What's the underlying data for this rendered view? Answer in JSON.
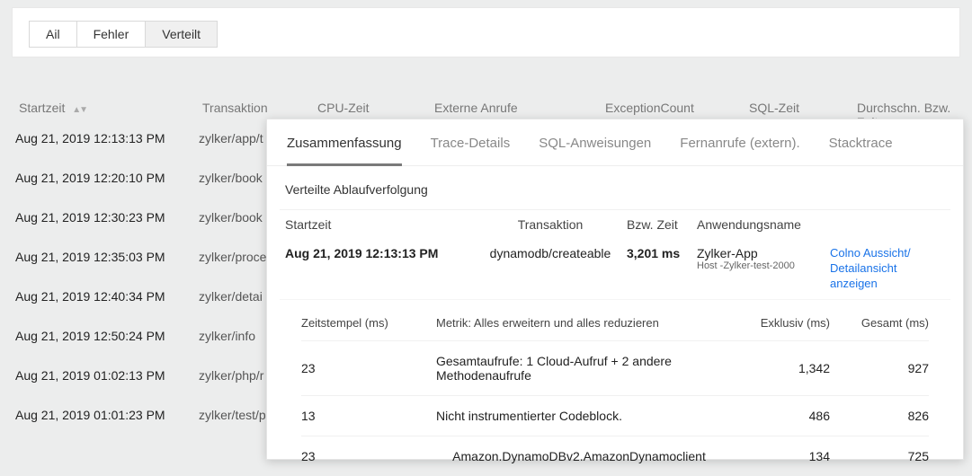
{
  "filters": {
    "all": "Ail",
    "errors": "Fehler",
    "distributed": "Verteilt"
  },
  "columns": {
    "start": "Startzeit",
    "transaction": "Transaktion",
    "cpu": "CPU-Zeit",
    "external": "Externe Anrufe",
    "exception": "ExceptionCount",
    "sql": "SQL-Zeit",
    "avg": "Durchschn. Bzw. Zeit"
  },
  "rows": [
    {
      "start": "Aug 21, 2019 12:13:13 PM",
      "trans": "zylker/app/t"
    },
    {
      "start": "Aug 21, 2019 12:20:10 PM",
      "trans": "zylker/book"
    },
    {
      "start": "Aug 21, 2019 12:30:23 PM",
      "trans": "zylker/book"
    },
    {
      "start": "Aug 21, 2019 12:35:03 PM",
      "trans": "zylker/proce"
    },
    {
      "start": "Aug 21, 2019 12:40:34 PM",
      "trans": "zylker/detai"
    },
    {
      "start": "Aug 21, 2019 12:50:24 PM",
      "trans": "zylker/info"
    },
    {
      "start": "Aug 21, 2019 01:02:13 PM",
      "trans": "zylker/php/r"
    },
    {
      "start": "Aug 21, 2019 01:01:23 PM",
      "trans": "zylker/test/p"
    }
  ],
  "detail_tabs": {
    "summary": "Zusammenfassung",
    "trace": "Trace-Details",
    "sql": "SQL-Anweisungen",
    "remote": "Fernanrufe (extern).",
    "stack": "Stacktrace"
  },
  "section_title": "Verteilte Ablaufverfolgung",
  "trace_columns": {
    "start": "Startzeit",
    "transaction": "Transaktion",
    "duration": "Bzw. Zeit",
    "app": "Anwendungsname"
  },
  "trace_row": {
    "start": "Aug 21, 2019 12:13:13 PM",
    "transaction": "dynamodb/createable",
    "duration": "3,201 ms",
    "app_name": "Zylker-App",
    "app_host": "Host -Zylker-test-2000",
    "link1": "Colno Aussicht/",
    "link2": "Detailansicht anzeigen"
  },
  "inner_columns": {
    "timestamp": "Zeitstempel (ms)",
    "metric": "Metrik: Alles erweitern und alles reduzieren",
    "exclusive": "Exklusiv (ms)",
    "total": "Gesamt (ms)"
  },
  "inner_rows": [
    {
      "ts": "23",
      "metric": "Gesamtaufrufe: 1 Cloud-Aufruf + 2 andere Methodenaufrufe",
      "excl": "1,342",
      "tot": "927"
    },
    {
      "ts": "13",
      "metric": "Nicht instrumentierter Codeblock.",
      "excl": "486",
      "tot": "826"
    },
    {
      "ts": "23",
      "metric": "Amazon.DynamoDBv2.AmazonDynamoclient",
      "excl": "134",
      "tot": "725"
    }
  ]
}
